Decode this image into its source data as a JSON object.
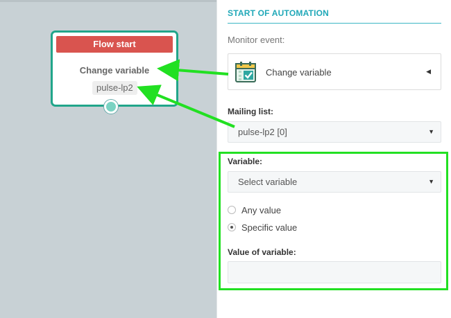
{
  "flow_node": {
    "header": "Flow start",
    "title": "Change variable",
    "tag": "pulse-lp2"
  },
  "panel": {
    "title": "START OF AUTOMATION",
    "monitor_event_label": "Monitor event:",
    "event": {
      "icon": "calendar-check-icon",
      "label": "Change variable"
    },
    "mailing_list": {
      "label": "Mailing list:",
      "value": "pulse-lp2 [0]"
    },
    "variable": {
      "label": "Variable:",
      "value": "Select variable"
    },
    "radio_options": [
      {
        "label": "Any value",
        "checked": false
      },
      {
        "label": "Specific value",
        "checked": true
      }
    ],
    "value_of_variable": {
      "label": "Value of variable:",
      "value": ""
    }
  },
  "colors": {
    "node_border": "#21a58a",
    "node_header": "#d9544f",
    "panel_title": "#20a8b8",
    "annotation_green": "#22e022",
    "canvas": "#c8d1d5"
  }
}
